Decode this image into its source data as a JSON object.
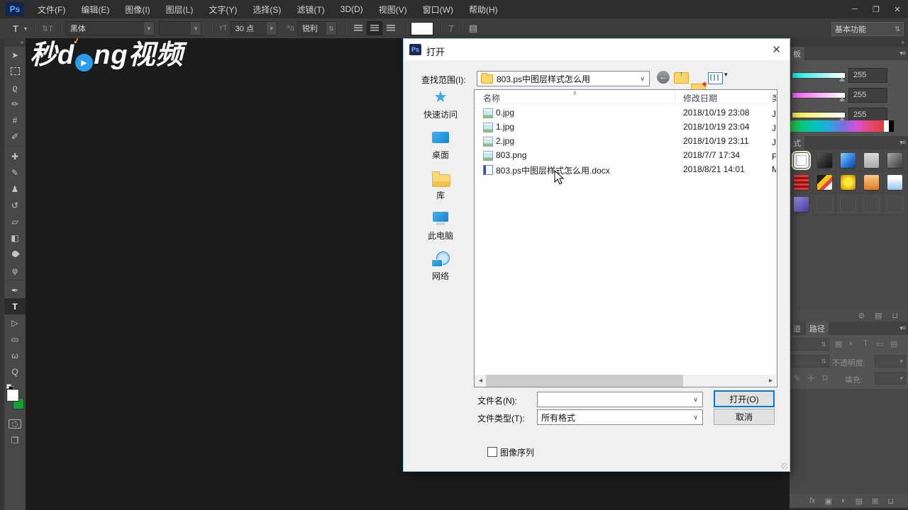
{
  "app": {
    "logo": "Ps",
    "menus": [
      "文件(F)",
      "编辑(E)",
      "图像(I)",
      "图层(L)",
      "文字(Y)",
      "选择(S)",
      "滤镜(T)",
      "3D(D)",
      "视图(V)",
      "窗口(W)",
      "帮助(H)"
    ],
    "window": {
      "minimize": "─",
      "restore": "❒",
      "close": "✕"
    },
    "options": {
      "tool_glyph": "T",
      "tool_arrow": "▾",
      "orientation_glyph": "⇅T",
      "font_family": "黑体",
      "font_style": "",
      "size_glyph": "тT",
      "font_size": "30 点",
      "aa_glyph": "ªa",
      "antialias": "锐利",
      "spin": "⇅",
      "color_swatch": "#ffffff",
      "warp_glyph": "T",
      "panel_glyph": "▤",
      "workspace": "基本功能"
    },
    "watermark": {
      "part1": "秒d",
      "part2": "ng视频",
      "play": "▶",
      "accent": "✓"
    },
    "toolbar": {
      "collapse": "»",
      "fg_color": "#ffffff",
      "bg_color": "#12a233",
      "tools": [
        {
          "name": "move-tool",
          "glyph": "➤"
        },
        {
          "name": "marquee-tool",
          "glyph": ""
        },
        {
          "name": "lasso-tool",
          "glyph": "ϱ"
        },
        {
          "name": "quick-selection-tool",
          "glyph": "✏"
        },
        {
          "name": "crop-tool",
          "glyph": "#"
        },
        {
          "name": "eyedropper-tool",
          "glyph": "✐"
        },
        {
          "name": "spot-healing-tool",
          "glyph": "✚"
        },
        {
          "name": "brush-tool",
          "glyph": "✎"
        },
        {
          "name": "clone-stamp-tool",
          "glyph": "♟"
        },
        {
          "name": "history-brush-tool",
          "glyph": "↺"
        },
        {
          "name": "eraser-tool",
          "glyph": "▱"
        },
        {
          "name": "gradient-tool",
          "glyph": "◧"
        },
        {
          "name": "blur-tool",
          "glyph": ""
        },
        {
          "name": "dodge-tool",
          "glyph": "φ"
        },
        {
          "name": "pen-tool",
          "glyph": "✒"
        },
        {
          "name": "type-tool",
          "glyph": "T"
        },
        {
          "name": "path-selection-tool",
          "glyph": "▷"
        },
        {
          "name": "rectangle-tool",
          "glyph": "▭"
        },
        {
          "name": "hand-tool",
          "glyph": "ω"
        },
        {
          "name": "zoom-tool",
          "glyph": "Q"
        }
      ]
    }
  },
  "panels": {
    "collapse": "»",
    "menu_glyph": "▾≡",
    "color": {
      "tab": "板",
      "sliders": [
        {
          "track": "linear-gradient(to right,#17e9e2,#ffffff)",
          "value": "255"
        },
        {
          "track": "linear-gradient(to right,#f25cf2,#ffffff)",
          "value": "255"
        },
        {
          "track": "linear-gradient(to right,#f2ee4a,#ffffff)",
          "value": "255"
        }
      ],
      "spectrum": "linear-gradient(to right,#3fbf3f,#00c97b,#00c3c3,#2aa4e0,#7a6fe0,#d94fd9,#e8486f,#e03c3c)",
      "spectrum_white": "#ffffff",
      "spectrum_black": "#000000"
    },
    "styles": {
      "tab": "式",
      "clear_glyph": "⊘",
      "new_glyph": "▤",
      "delete_glyph": "⊔",
      "swatches": [
        {
          "bg": ""
        },
        {
          "bg": "linear-gradient(135deg,#555555,#0d0d0d)"
        },
        {
          "bg": "linear-gradient(135deg,#8fd0ff 0%,#2b7fe0 55%,#143e8a 100%)"
        },
        {
          "bg": "linear-gradient(180deg,#dcdcdc,#a9a9a9)"
        },
        {
          "bg": "linear-gradient(135deg,#a8a8a8,#3b3b3b)"
        },
        {
          "bg": "repeating-linear-gradient(180deg,#e23a3a 0 3px,#8e1414 3px 6px)"
        },
        {
          "bg": "linear-gradient(135deg,#1c1c1c 0 32%,#f2c21a 32% 55%,#e04545 55% 72%,#f2f2f2 72%)"
        },
        {
          "bg": "radial-gradient(circle,#ffe83a 35%,#e0a800 75%,#8a6400 100%)"
        },
        {
          "bg": "linear-gradient(180deg,#f7c98a,#e07b2a)"
        },
        {
          "bg": "linear-gradient(180deg,#ffffff 20%,#8ec6f0)"
        },
        {
          "bg": "linear-gradient(135deg,#9a90e8,#453a9e)"
        }
      ]
    },
    "layers": {
      "tab_channels": "道",
      "tab_paths": "路径",
      "spin": "⇅",
      "dropdown": "▾",
      "filter_icons": [
        "▦",
        "◐",
        "T",
        "▭",
        "▤"
      ],
      "opacity_label": "不透明度:",
      "fill_label": "填充:",
      "lock_icons": [
        "✎",
        "✛",
        "Ω"
      ],
      "bottom_icons": [
        "fx",
        "▣",
        "◐",
        "▤",
        "⊞",
        "⊔"
      ]
    }
  },
  "dialog": {
    "icon": "Ps",
    "title": "打开",
    "close": "✕",
    "address_label": "查找范围(I):",
    "address_value": "803.ps中图层样式怎么用",
    "address_arrow": "∨",
    "nav": {
      "back": "←",
      "up": "↑",
      "new_star": "✱",
      "views_arrow": "▾",
      "star": "✱"
    },
    "sidebar": [
      "快速访问",
      "桌面",
      "库",
      "此电脑",
      "网络"
    ],
    "columns": {
      "name": "名称",
      "sort": "∧",
      "date": "修改日期",
      "type": "类型"
    },
    "files": [
      {
        "name": "0.jpg",
        "date": "2018/10/19 23:08",
        "type": "JPG 文件"
      },
      {
        "name": "1.jpg",
        "date": "2018/10/19 23:04",
        "type": "JPG 文件"
      },
      {
        "name": "2.jpg",
        "date": "2018/10/19 23:11",
        "type": "JPG 文件"
      },
      {
        "name": "803.png",
        "date": "2018/7/7 17:34",
        "type": "PNG 文件"
      },
      {
        "name": "803.ps中图层样式怎么用.docx",
        "date": "2018/8/21 14:01",
        "type": "M"
      }
    ],
    "scroll": {
      "left": "◂",
      "right": "▸"
    },
    "filename_label": "文件名(N):",
    "filename_value": "",
    "filetype_label": "文件类型(T):",
    "filetype_value": "所有格式",
    "open_button": "打开(O)",
    "cancel_button": "取消",
    "sequence_label": "图像序列"
  }
}
